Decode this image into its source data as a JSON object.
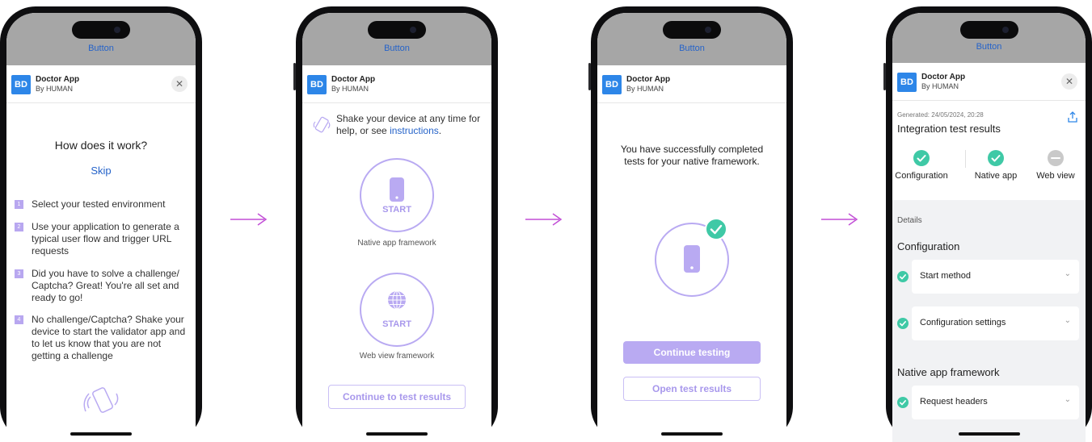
{
  "common": {
    "top_button_label": "Button",
    "badge": "BD",
    "app_name": "Doctor App",
    "app_by": "By HUMAN",
    "close_glyph": "✕"
  },
  "onboarding": {
    "title": "How does it work?",
    "skip": "Skip",
    "steps": [
      {
        "num": "1",
        "text": "Select your tested environment"
      },
      {
        "num": "2",
        "text": "Use your application to generate a typical user flow and trigger URL requests"
      },
      {
        "num": "3",
        "text": "Did you have to solve a challenge/ Captcha? Great! You're all set and ready to go!"
      },
      {
        "num": "4",
        "text": "No challenge/Captcha? Shake your device to start the validator app and to let us know that you are not getting a challenge"
      }
    ]
  },
  "frameworks": {
    "shake_text": "Shake your device at any time for help, or see",
    "shake_link": "instructions",
    "shake_end": ".",
    "native_start": "START",
    "native_label": "Native app framework",
    "web_start": "START",
    "web_label": "Web view framework",
    "continue_button": "Continue to test results"
  },
  "success": {
    "message": "You have successfully completed tests for your native framework.",
    "continue_button": "Continue testing",
    "open_results_button": "Open test results"
  },
  "results": {
    "generated": "Generated: 24/05/2024, 20:28",
    "title": "Integration test results",
    "tabs": [
      {
        "label": "Configuration",
        "status": "passed"
      },
      {
        "label": "Native app",
        "status": "passed"
      },
      {
        "label": "Web view",
        "status": "skipped"
      }
    ],
    "details_label": "Details",
    "section_config": "Configuration",
    "config_rows": [
      "Start method",
      "Configuration settings"
    ],
    "section_native": "Native app framework",
    "native_rows": [
      "Request headers"
    ]
  },
  "colors": {
    "accent_purple": "#b9aaf2",
    "link_blue": "#2563c9",
    "check_teal": "#3fc9a6",
    "arrow": "#c24fd6"
  }
}
